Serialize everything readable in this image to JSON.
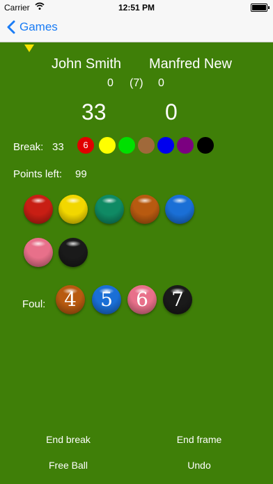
{
  "status_bar": {
    "carrier": "Carrier",
    "time": "12:51 PM"
  },
  "nav": {
    "back_label": "Games"
  },
  "players": [
    {
      "name": "John Smith",
      "frames": "0",
      "score": "33"
    },
    {
      "name": "Manfred New",
      "frames": "0",
      "score": "0"
    }
  ],
  "frames_total": "(7)",
  "break": {
    "label": "Break:",
    "value": "33",
    "first_ball_value": "6",
    "ball_colors": [
      "#e00000",
      "#ffff00",
      "#00e000",
      "#a0693a",
      "#0000ee",
      "#7b0080",
      "#000000"
    ]
  },
  "points_left": {
    "label": "Points left:",
    "value": "99"
  },
  "pot_balls": [
    {
      "name": "red",
      "color": "#c81e14"
    },
    {
      "name": "yellow",
      "color": "#f2d700"
    },
    {
      "name": "green",
      "color": "#0f8a64"
    },
    {
      "name": "brown",
      "color": "#b85a10"
    },
    {
      "name": "blue",
      "color": "#1a6fd6"
    },
    {
      "name": "pink",
      "color": "#e8708a"
    },
    {
      "name": "black",
      "color": "#1a1a1a"
    }
  ],
  "foul": {
    "label": "Foul:",
    "balls": [
      {
        "value": "4",
        "color": "#b85a10"
      },
      {
        "value": "5",
        "color": "#1a6fd6"
      },
      {
        "value": "6",
        "color": "#e8708a"
      },
      {
        "value": "7",
        "color": "#1a1a1a"
      }
    ]
  },
  "actions": {
    "end_break": "End break",
    "end_frame": "End frame",
    "free_ball": "Free Ball",
    "undo": "Undo"
  }
}
